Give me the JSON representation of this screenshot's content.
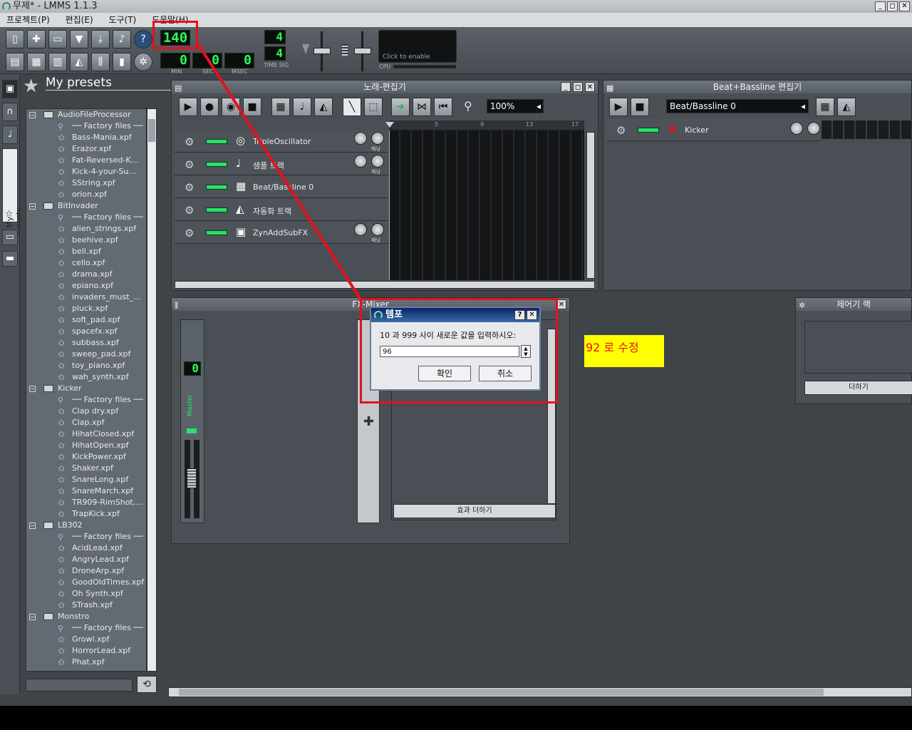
{
  "window": {
    "title": "무제* - LMMS 1.1.3",
    "controls": [
      "_",
      "◻",
      "✕"
    ]
  },
  "menu": [
    "프로젝트(P)",
    "편집(E)",
    "도구(T)",
    "도움말(H)"
  ],
  "toolbar": {
    "tempo": "140",
    "min_value": "0",
    "sec_value": "0",
    "msec_value": "0",
    "min_label": "MIN",
    "sec_label": "SEC",
    "msec_label": "MSEC",
    "timesig_num": "4",
    "timesig_den": "4",
    "timesig_label": "TIME SIG",
    "cpu_hint": "Click to enable",
    "cpu_label": "CPU"
  },
  "sidebar": {
    "panel_title": "My presets",
    "vertical_tab": "My presets"
  },
  "tree": [
    {
      "type": "folder",
      "label": "AudioFileProcessor"
    },
    {
      "type": "factory",
      "label": "── Factory files ──"
    },
    {
      "type": "file",
      "label": "Bass-Mania.xpf"
    },
    {
      "type": "file",
      "label": "Erazor.xpf"
    },
    {
      "type": "file",
      "label": "Fat-Reversed-K…"
    },
    {
      "type": "file",
      "label": "Kick-4-your-Su…"
    },
    {
      "type": "file",
      "label": "SString.xpf"
    },
    {
      "type": "file",
      "label": "orion.xpf"
    },
    {
      "type": "folder",
      "label": "BitInvader"
    },
    {
      "type": "factory",
      "label": "── Factory files ──"
    },
    {
      "type": "file",
      "label": "alien_strings.xpf"
    },
    {
      "type": "file",
      "label": "beehive.xpf"
    },
    {
      "type": "file",
      "label": "bell.xpf"
    },
    {
      "type": "file",
      "label": "cello.xpf"
    },
    {
      "type": "file",
      "label": "drama.xpf"
    },
    {
      "type": "file",
      "label": "epiano.xpf"
    },
    {
      "type": "file",
      "label": "invaders_must_…"
    },
    {
      "type": "file",
      "label": "pluck.xpf"
    },
    {
      "type": "file",
      "label": "soft_pad.xpf"
    },
    {
      "type": "file",
      "label": "spacefx.xpf"
    },
    {
      "type": "file",
      "label": "subbass.xpf"
    },
    {
      "type": "file",
      "label": "sweep_pad.xpf"
    },
    {
      "type": "file",
      "label": "toy_piano.xpf"
    },
    {
      "type": "file",
      "label": "wah_synth.xpf"
    },
    {
      "type": "folder",
      "label": "Kicker"
    },
    {
      "type": "factory",
      "label": "── Factory files ──"
    },
    {
      "type": "file",
      "label": "Clap dry.xpf"
    },
    {
      "type": "file",
      "label": "Clap.xpf"
    },
    {
      "type": "file",
      "label": "HihatClosed.xpf"
    },
    {
      "type": "file",
      "label": "HihatOpen.xpf"
    },
    {
      "type": "file",
      "label": "KickPower.xpf"
    },
    {
      "type": "file",
      "label": "Shaker.xpf"
    },
    {
      "type": "file",
      "label": "SnareLong.xpf"
    },
    {
      "type": "file",
      "label": "SnareMarch.xpf"
    },
    {
      "type": "file",
      "label": "TR909-RimShot.…"
    },
    {
      "type": "file",
      "label": "TrapKick.xpf"
    },
    {
      "type": "folder",
      "label": "LB302"
    },
    {
      "type": "factory",
      "label": "── Factory files ──"
    },
    {
      "type": "file",
      "label": "AcidLead.xpf"
    },
    {
      "type": "file",
      "label": "AngryLead.xpf"
    },
    {
      "type": "file",
      "label": "DroneArp.xpf"
    },
    {
      "type": "file",
      "label": "GoodOldTimes.xpf"
    },
    {
      "type": "file",
      "label": "Oh Synth.xpf"
    },
    {
      "type": "file",
      "label": "STrash.xpf"
    },
    {
      "type": "folder",
      "label": "Monstro"
    },
    {
      "type": "factory",
      "label": "── Factory files ──"
    },
    {
      "type": "file",
      "label": "Growl.xpf"
    },
    {
      "type": "file",
      "label": "HorrorLead.xpf"
    },
    {
      "type": "file",
      "label": "Phat.xpf"
    }
  ],
  "song_editor": {
    "title": "노래-편집기",
    "zoom": "100%",
    "ruler": [
      "1",
      "5",
      "9",
      "13",
      "17"
    ],
    "tracks": [
      {
        "name": "TripleOscillator",
        "icon": "oscillator-icon",
        "knobs": true
      },
      {
        "name": "샘플 트랙",
        "icon": "note-icon",
        "knobs": true
      },
      {
        "name": "Beat/Bassline 0",
        "icon": "beat-icon",
        "knobs": false
      },
      {
        "name": "자동화 트랙",
        "icon": "automation-icon",
        "knobs": false
      },
      {
        "name": "ZynAddSubFX",
        "icon": "zyn-icon",
        "knobs": true
      }
    ],
    "knob_label": "패닝"
  },
  "bb_editor": {
    "title": "Beat+Bassline 편집기",
    "selector": "Beat/Bassline 0",
    "track_name": "Kicker"
  },
  "fx_mixer": {
    "title": "FX-Mixer",
    "master_label": "Master",
    "master_lcd": "0",
    "add_effect": "효과 더하기"
  },
  "controller_rack": {
    "title": "제어기 랙",
    "add_button": "더하기"
  },
  "dialog": {
    "title": "템포",
    "prompt": "10 과 999 사이 새로운 값을 입력하시오:",
    "value": "96",
    "ok": "확인",
    "cancel": "취소",
    "help": "?",
    "close": "✕"
  },
  "annotation": {
    "note": "92 로 수정",
    "color": "#e3121b"
  }
}
